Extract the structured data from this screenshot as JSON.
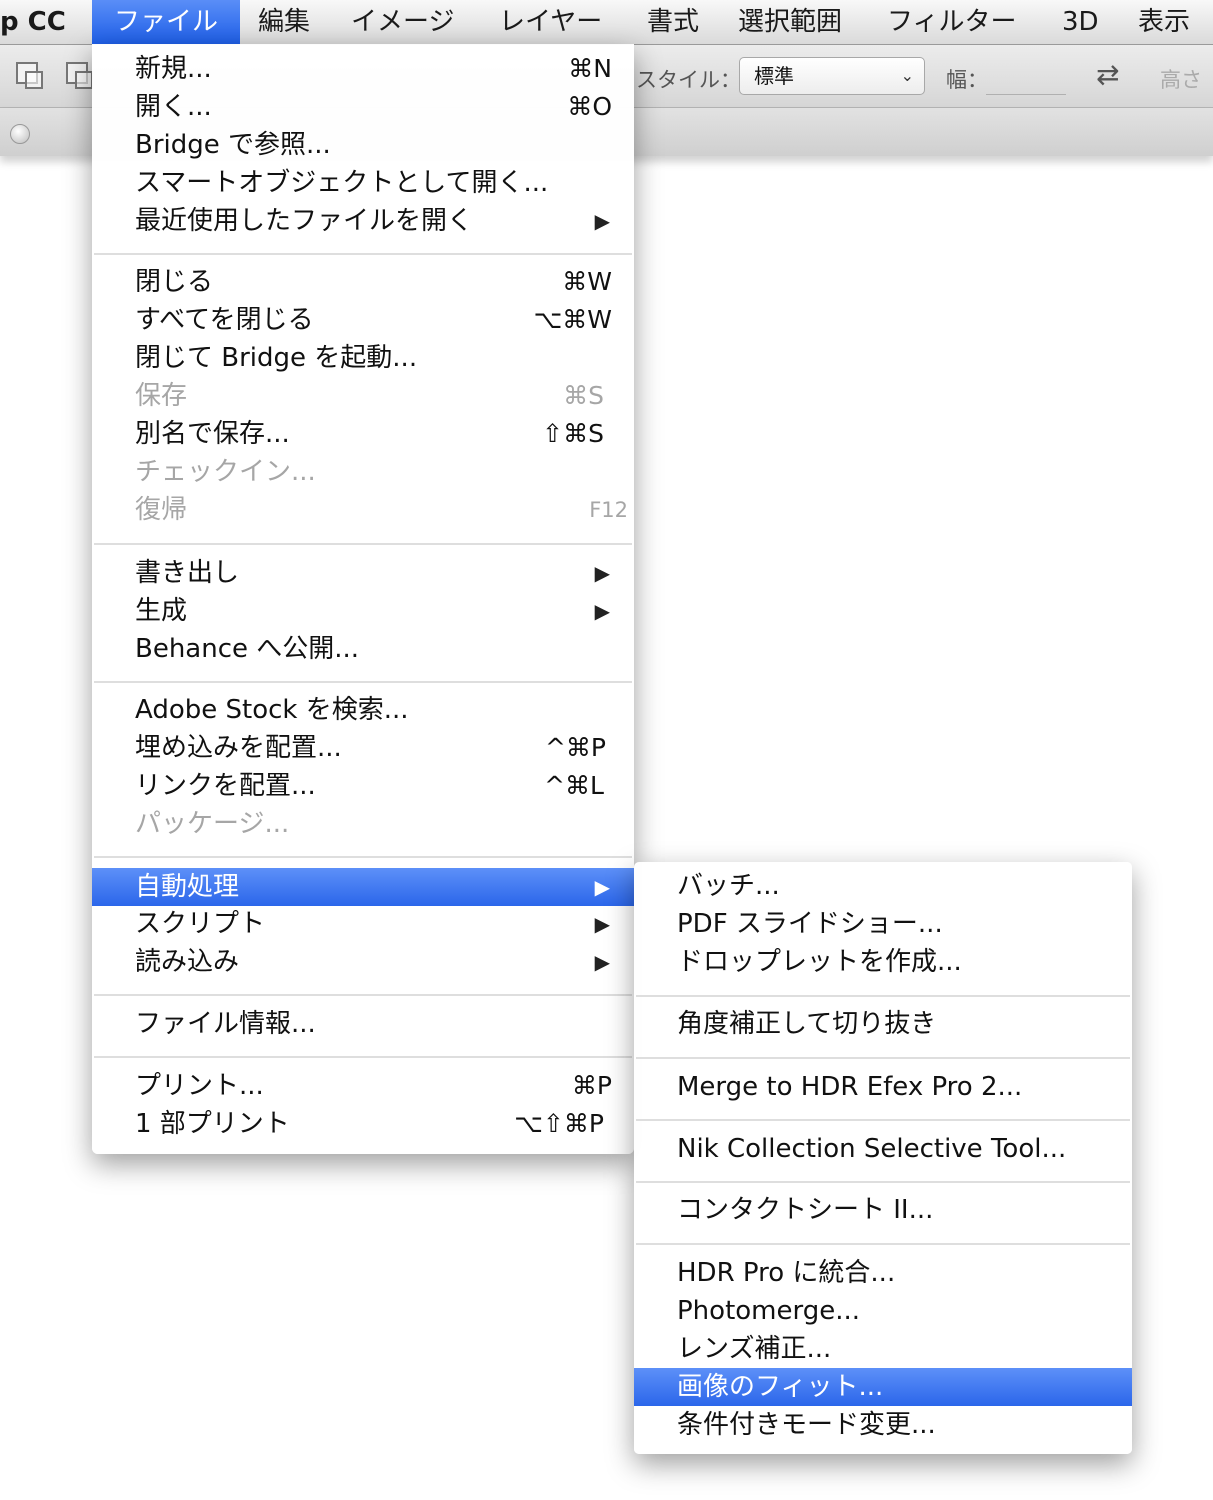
{
  "menubar": {
    "app": "p CC",
    "items": [
      "ファイル",
      "編集",
      "イメージ",
      "レイヤー",
      "書式",
      "選択範囲",
      "フィルター",
      "3D",
      "表示"
    ]
  },
  "options_bar": {
    "style_label": "スタイル：",
    "style_value": "標準",
    "width_label": "幅：",
    "height_label": "高さ"
  },
  "file_menu": {
    "items": [
      {
        "label": "新規...",
        "shortcut": "⌘N"
      },
      {
        "label": "開く...",
        "shortcut": "⌘O"
      },
      {
        "label": "Bridge で参照..."
      },
      {
        "label": "スマートオブジェクトとして開く..."
      },
      {
        "label": "最近使用したファイルを開く",
        "submenu": true
      },
      {
        "label": "閉じる",
        "shortcut": "⌘W"
      },
      {
        "label": "すべてを閉じる",
        "shortcut": "⌥⌘W"
      },
      {
        "label": "閉じて Bridge を起動..."
      },
      {
        "label": "保存",
        "shortcut": "⌘S",
        "disabled": true
      },
      {
        "label": "別名で保存...",
        "shortcut": "⇧⌘S"
      },
      {
        "label": "チェックイン...",
        "disabled": true
      },
      {
        "label": "復帰",
        "shortcut": "F12",
        "disabled": true
      },
      {
        "label": "書き出し",
        "submenu": true
      },
      {
        "label": "生成",
        "submenu": true
      },
      {
        "label": "Behance へ公開..."
      },
      {
        "label": "Adobe Stock を検索..."
      },
      {
        "label": "埋め込みを配置...",
        "shortcut": "^⌘P"
      },
      {
        "label": "リンクを配置...",
        "shortcut": "^⌘L"
      },
      {
        "label": "パッケージ...",
        "disabled": true
      },
      {
        "label": "自動処理",
        "submenu": true,
        "highlighted": true
      },
      {
        "label": "スクリプト",
        "submenu": true
      },
      {
        "label": "読み込み",
        "submenu": true
      },
      {
        "label": "ファイル情報..."
      },
      {
        "label": "プリント...",
        "shortcut": "⌘P"
      },
      {
        "label": "1 部プリント",
        "shortcut": "⌥⇧⌘P"
      }
    ]
  },
  "automate_submenu": {
    "items": [
      {
        "label": "バッチ..."
      },
      {
        "label": "PDF スライドショー..."
      },
      {
        "label": "ドロップレットを作成..."
      },
      {
        "label": "角度補正して切り抜き"
      },
      {
        "label": "Merge to HDR Efex Pro 2..."
      },
      {
        "label": "Nik Collection Selective Tool..."
      },
      {
        "label": "コンタクトシート II..."
      },
      {
        "label": "HDR Pro に統合..."
      },
      {
        "label": "Photomerge..."
      },
      {
        "label": "レンズ補正..."
      },
      {
        "label": "画像のフィット...",
        "highlighted": true
      },
      {
        "label": "条件付きモード変更..."
      }
    ]
  },
  "colors": {
    "highlight": "#2b66ea",
    "disabled_text": "#a6a6a6",
    "separator": "#dedede"
  }
}
